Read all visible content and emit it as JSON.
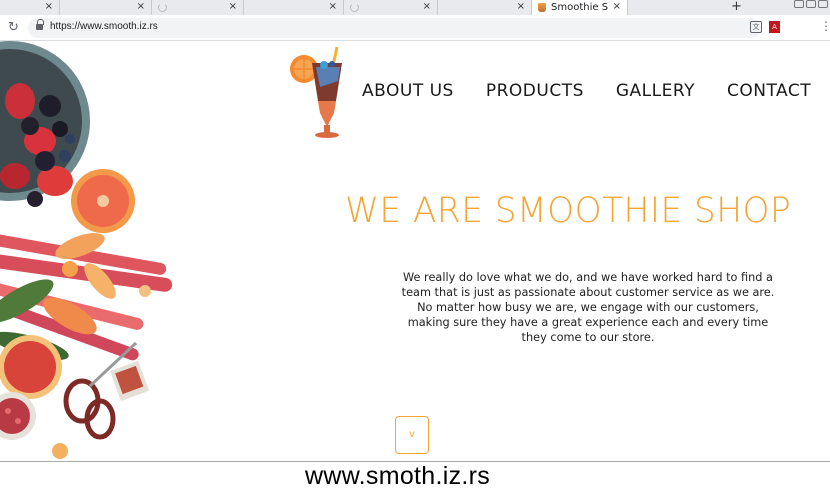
{
  "browser": {
    "tabs": [
      {
        "label": ""
      },
      {
        "label": ""
      },
      {
        "label": ""
      },
      {
        "label": ""
      },
      {
        "label": ""
      },
      {
        "label": ""
      },
      {
        "label": "Smoothie S"
      }
    ],
    "new_tab_label": "+",
    "close_glyph": "×",
    "reload_glyph": "C",
    "url": "https://www.smooth.iz.rs",
    "star_glyph": "☆",
    "menu_glyph": "⋮",
    "pdf_label": "A"
  },
  "nav": {
    "items": [
      "ABOUT US",
      "PRODUCTS",
      "GALLERY",
      "CONTACT"
    ]
  },
  "hero": {
    "headline": "WE ARE SMOOTHIE SHOP",
    "intro": "We really do love what we do, and we have worked hard to find a team that is just as passionate about customer service as we are. No matter how busy we are, we engage with our customers, making sure they have a great experience each and every time they come to our store.",
    "scroll_label": "v"
  },
  "caption": "www.smoth.iz.rs",
  "colors": {
    "accent": "#f5a436",
    "text": "#1a1a1a"
  },
  "icons": {
    "reload": "reload-icon",
    "lock": "lock-icon",
    "translate": "translate-icon",
    "star": "star-icon",
    "pdf": "pdf-extension-icon",
    "menu": "kebab-menu-icon"
  }
}
